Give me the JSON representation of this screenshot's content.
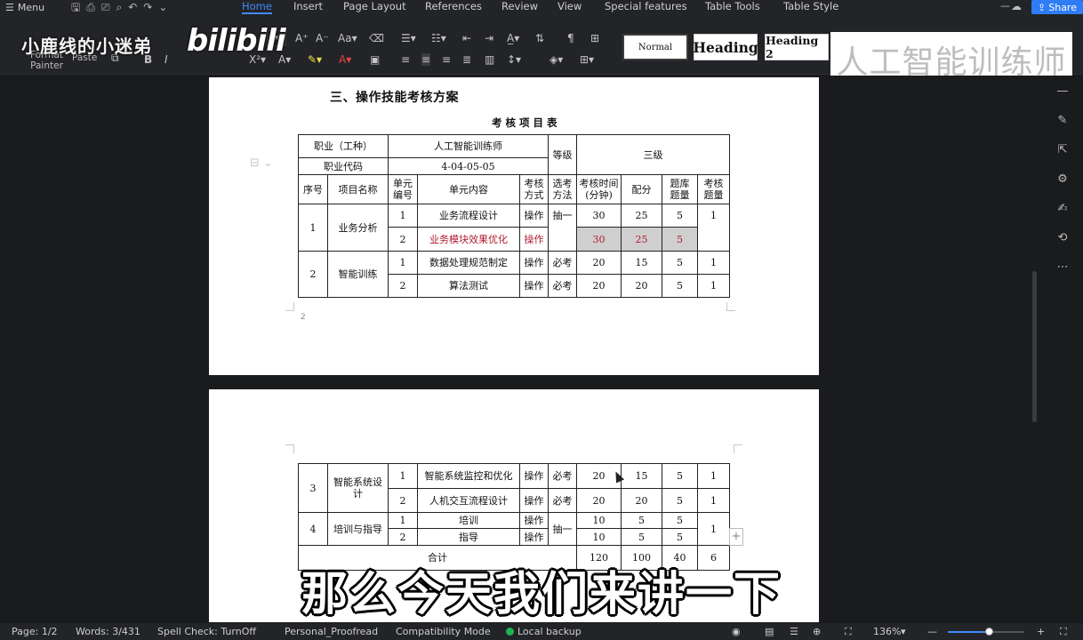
{
  "menubar": {
    "menu_label": "Menu",
    "tabs": [
      "Home",
      "Insert",
      "Page Layout",
      "References",
      "Review",
      "View",
      "Special features",
      "Table Tools",
      "Table Style"
    ],
    "active_tab": "Home",
    "share_label": "Share"
  },
  "ribbon": {
    "format_painter": "Format\nPainter",
    "paste": "Paste",
    "styles": {
      "normal": "Normal",
      "heading": "Heading",
      "heading2": "Heading 2",
      "custom": "人工智能训练师"
    }
  },
  "overlay": {
    "uploader": "小鹿线的小迷弟",
    "platform_logo": "bilibili",
    "subtitle": "那么今天我们来讲一下"
  },
  "document": {
    "heading": "三、操作技能考核方案",
    "table_title": "考核项目表",
    "header": {
      "occupation_label": "职业（工种）",
      "occupation_value": "人工智能训练师",
      "code_label": "职业代码",
      "code_value": "4-04-05-05",
      "level_label": "等级",
      "level_value": "三级"
    },
    "columns": [
      "序号",
      "项目名称",
      "单元\n编号",
      "单元内容",
      "考核\n方式",
      "选考\n方法",
      "考核时间\n(分钟)",
      "配分",
      "题库\n题量",
      "考核\n题量"
    ],
    "groups_page1": [
      {
        "no": "1",
        "name": "业务分析",
        "method": "抽一",
        "count": "1",
        "units": [
          {
            "id": "1",
            "content": "业务流程设计",
            "mode": "操作",
            "time": "30",
            "score": "25",
            "bank": "5"
          },
          {
            "id": "2",
            "content": "业务模块效果优化",
            "mode": "操作",
            "time": "30",
            "score": "25",
            "bank": "5"
          }
        ]
      },
      {
        "no": "2",
        "name": "智能训练",
        "units": [
          {
            "id": "1",
            "content": "数据处理规范制定",
            "mode": "操作",
            "method": "必考",
            "time": "20",
            "score": "15",
            "bank": "5",
            "count": "1"
          },
          {
            "id": "2",
            "content": "算法测试",
            "mode": "操作",
            "method": "必考",
            "time": "20",
            "score": "20",
            "bank": "5",
            "count": "1"
          }
        ]
      }
    ],
    "page1_number": "2",
    "groups_page2": [
      {
        "no": "3",
        "name": "智能系统设\n计",
        "units": [
          {
            "id": "1",
            "content": "智能系统监控和优化",
            "mode": "操作",
            "method": "必考",
            "time": "20",
            "score": "15",
            "bank": "5",
            "count": "1"
          },
          {
            "id": "2",
            "content": "人机交互流程设计",
            "mode": "操作",
            "method": "必考",
            "time": "20",
            "score": "20",
            "bank": "5",
            "count": "1"
          }
        ]
      },
      {
        "no": "4",
        "name": "培训与指导",
        "method": "抽一",
        "count": "1",
        "units": [
          {
            "id": "1",
            "content": "培训",
            "mode": "操作",
            "time": "10",
            "score": "5",
            "bank": "5"
          },
          {
            "id": "2",
            "content": "指导",
            "mode": "操作",
            "time": "10",
            "score": "5",
            "bank": "5"
          }
        ]
      }
    ],
    "total": {
      "label": "合计",
      "time": "120",
      "score": "100",
      "bank": "40",
      "count": "6"
    }
  },
  "statusbar": {
    "page": "Page: 1/2",
    "words": "Words: 3/431",
    "spell": "Spell Check: TurnOff",
    "proofread": "Personal_Proofread",
    "compat": "Compatibility Mode",
    "backup": "Local backup",
    "zoom": "136%",
    "zoom_level": 0.55
  },
  "colors": {
    "accent": "#3f8cff",
    "share": "#2f7cf6",
    "selection_text": "#b01c2e",
    "backup_ok": "#1fb352"
  }
}
